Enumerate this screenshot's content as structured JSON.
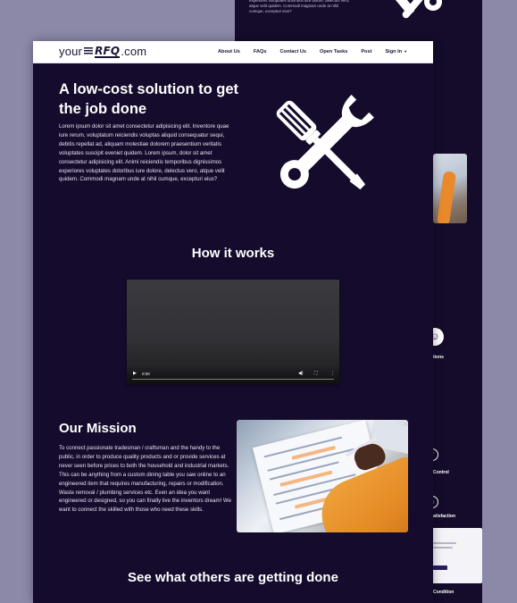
{
  "colors": {
    "page_background": "#150b2c",
    "navbar_background": "#ffffff",
    "outer_background": "#8c88a8",
    "accent_orange": "#e48924"
  },
  "background_page": {
    "text": "experiores voluptates doloribus iure dolore, delectus vero, atque velit quidem. Commodi magnam unde at nihil cumque, excepturi eius?",
    "labels": [
      "tions",
      "Control",
      "atisfaction",
      "Condition"
    ]
  },
  "navbar": {
    "logo_prefix": "your",
    "logo_mark": "RFQ",
    "logo_suffix": ".com",
    "links": [
      "About Us",
      "FAQs",
      "Contact Us",
      "Open Tasks",
      "Post"
    ],
    "sign_in": "Sign In",
    "sign_in_icon": "caret-down-icon"
  },
  "hero": {
    "title": "A low-cost solution to get the job done",
    "text": "Lorem ipsum dolor sit amet consectetur adipisicing elit. Inventore quae iure rerum, voluptatum reiciendis voluptas aliquid consequatur sequi, debitis repellat ad, aliquam molestiae dolorem praesentium veritatis voluptates suscipit eveniet quidem. Lorem ipsum, dolor sit amet consectetur adipisicing elit. Animi reiciendis temporibus dignissimos experiores voluptates doloribus iure dolore, delectus vero, atque velit quidem. Commodi magnam unde at nihil cumque, excepturi eius?",
    "icon": "wrench-screwdriver-icon"
  },
  "how_it_works": {
    "title": "How it works",
    "video": {
      "time": "0:00",
      "play_icon": "play-icon",
      "volume_icon": "volume-icon",
      "fullscreen_icon": "fullscreen-icon",
      "more_icon": "more-options-icon"
    }
  },
  "mission": {
    "title": "Our Mission",
    "text": "To connect passionate tradesman / craftsman and the handy to the public, in order to produce quality products and or provide services at never seen before prices to both the household and industrial markets. This can be anything from a custom dining table you saw online to an engineered item that requires manufacturing, repairs or modification. Waste removal / plumbing services etc. Even an idea you want engineered or designed, so you can finally live the inventors dream! We want to connect the skilled with those who need these skills."
  },
  "others": {
    "title": "See what others are getting done"
  }
}
